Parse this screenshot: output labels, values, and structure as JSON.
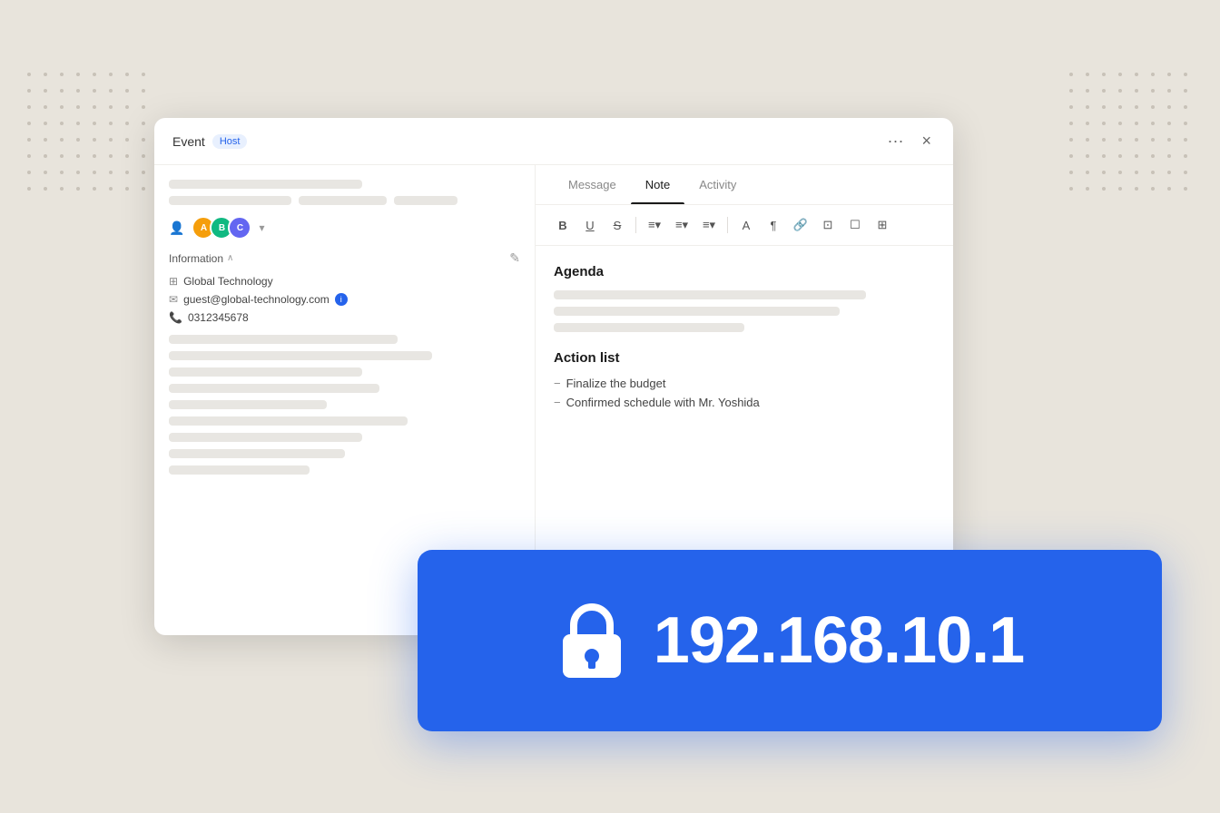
{
  "background_color": "#e8e4dc",
  "dots": {
    "count": 64
  },
  "dialog": {
    "header": {
      "title": "Event",
      "badge": "Host",
      "more_label": "···",
      "close_label": "×"
    },
    "left_panel": {
      "info_section_label": "Information",
      "company": "Global Technology",
      "email": "guest@global-technology.com",
      "phone": "0312345678"
    },
    "tabs": [
      {
        "label": "Message",
        "active": false
      },
      {
        "label": "Note",
        "active": true
      },
      {
        "label": "Activity",
        "active": false
      }
    ],
    "toolbar": {
      "buttons": [
        "B",
        "U",
        "S",
        "≡▾",
        "≡▾",
        "≡▾",
        "A",
        "¶",
        "🔗",
        "⊡",
        "☐",
        "⊞"
      ]
    },
    "editor": {
      "agenda_title": "Agenda",
      "action_list_title": "Action list",
      "action_items": [
        "Finalize the budget",
        "Confirmed schedule with Mr. Yoshida"
      ]
    }
  },
  "banner": {
    "ip_address": "192.168.10.1",
    "lock_icon_label": "lock-icon"
  }
}
